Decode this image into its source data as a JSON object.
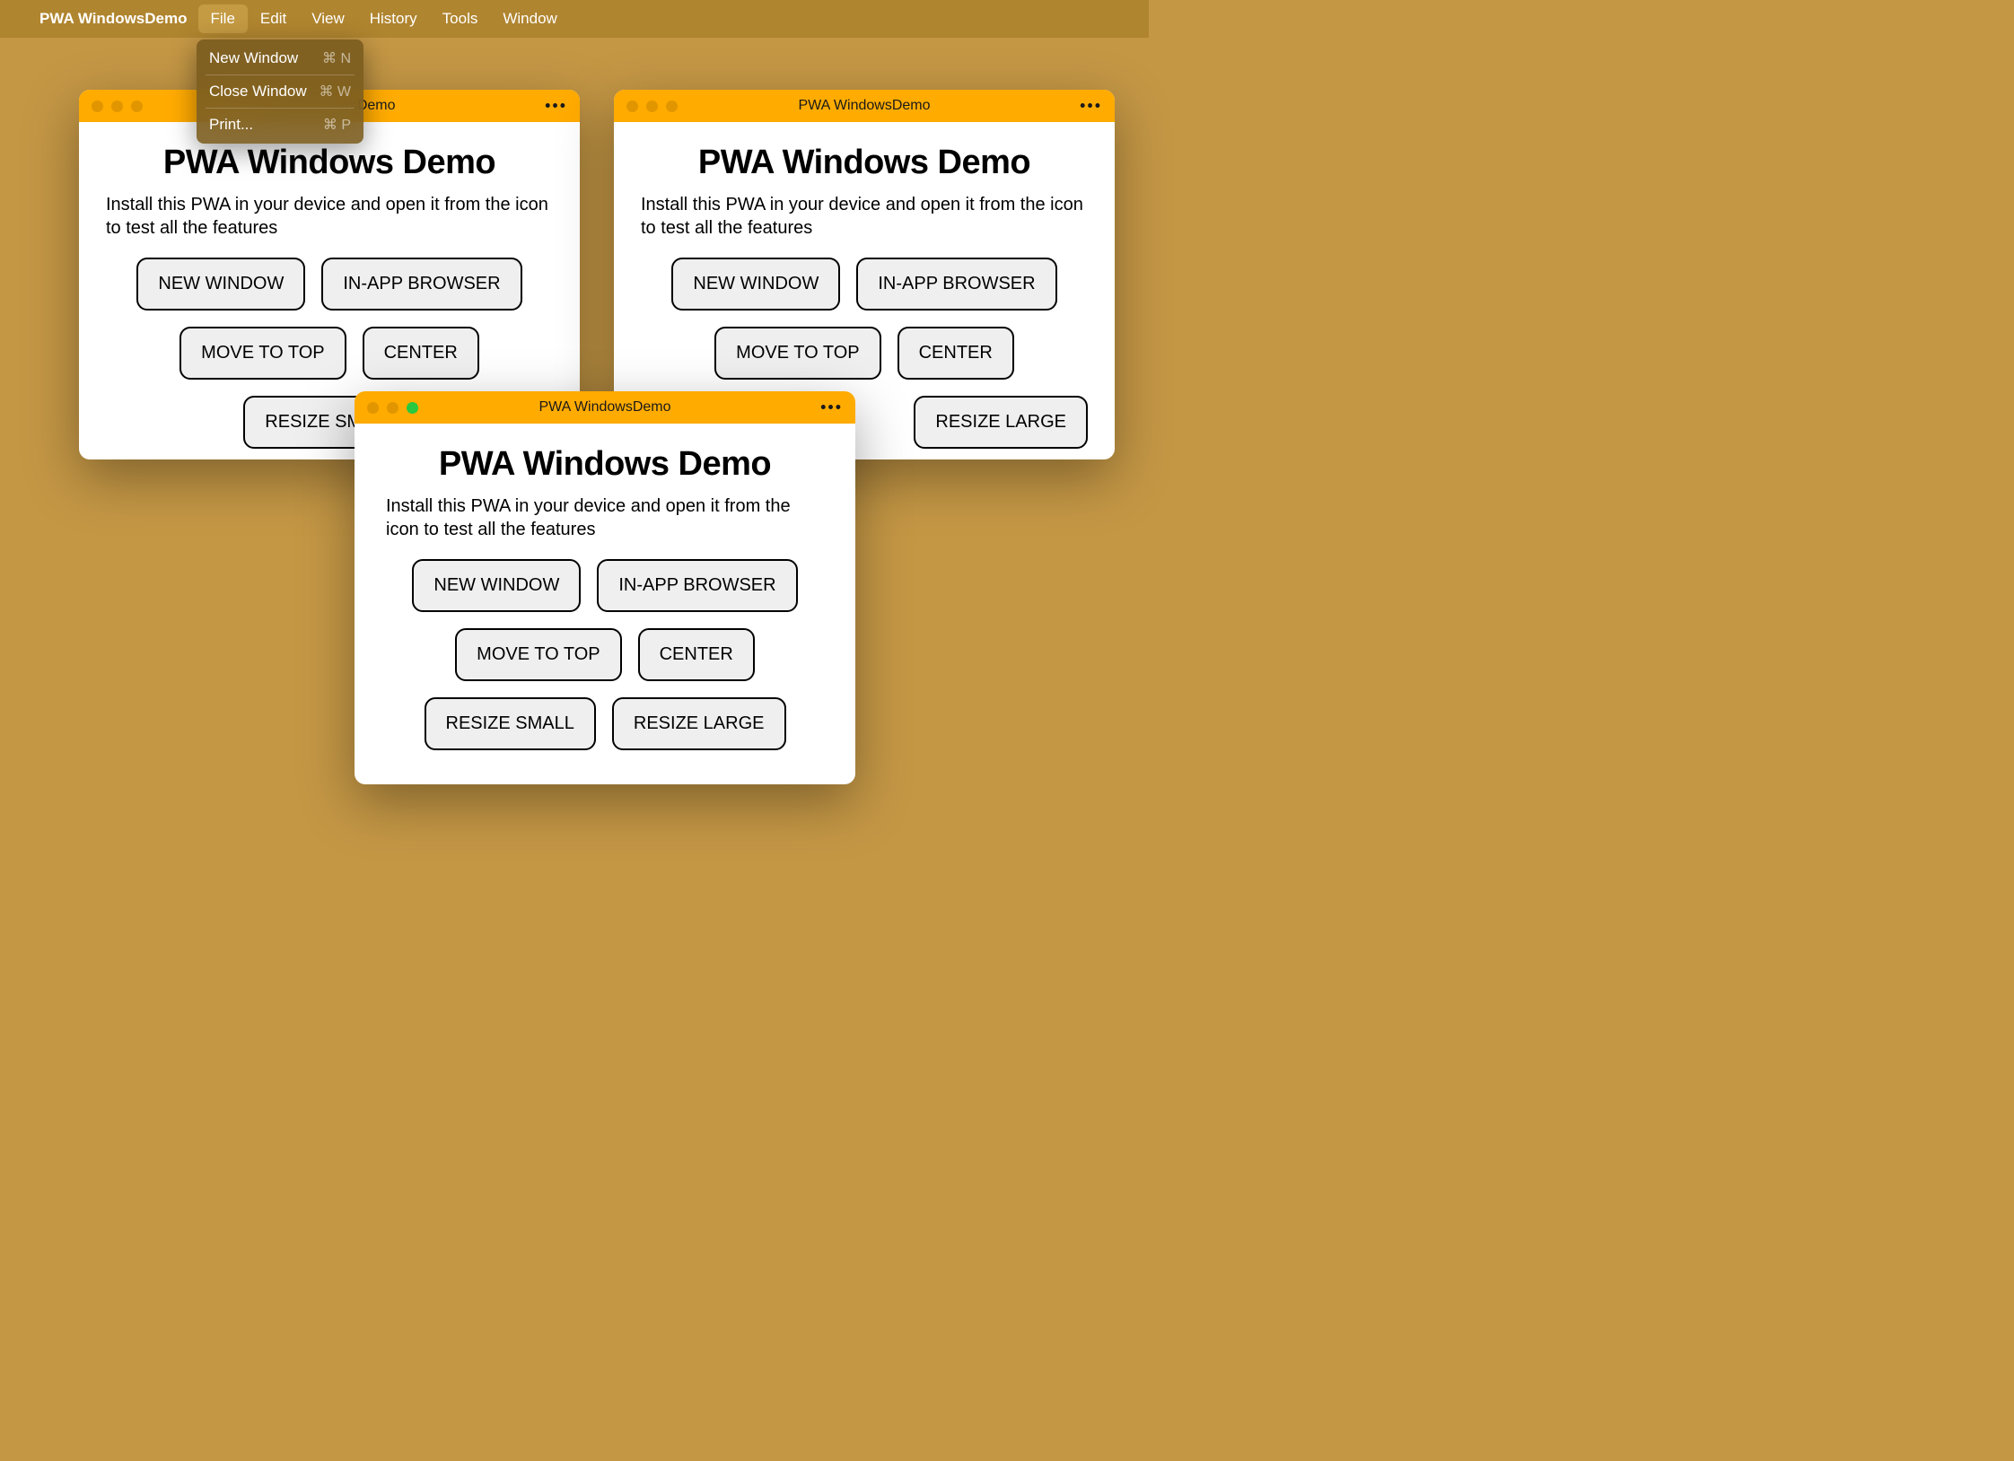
{
  "menubar": {
    "app_name": "PWA WindowsDemo",
    "items": [
      {
        "label": "File",
        "active": true
      },
      {
        "label": "Edit",
        "active": false
      },
      {
        "label": "View",
        "active": false
      },
      {
        "label": "History",
        "active": false
      },
      {
        "label": "Tools",
        "active": false
      },
      {
        "label": "Window",
        "active": false
      }
    ]
  },
  "dropdown": {
    "items": [
      {
        "label": "New Window",
        "shortcut": "⌘ N",
        "after_separator": true
      },
      {
        "label": "Close Window",
        "shortcut": "⌘ W",
        "after_separator": true
      },
      {
        "label": "Print...",
        "shortcut": "⌘ P",
        "after_separator": false
      }
    ]
  },
  "windows": [
    {
      "id": "w1",
      "active": false,
      "title": "PWA WindowsDemo",
      "heading": "PWA Windows Demo",
      "description": "Install this PWA in your device and open it from the icon to test all the features",
      "buttons": [
        "NEW WINDOW",
        "IN-APP BROWSER",
        "MOVE TO TOP",
        "CENTER",
        "RESIZE SMALL"
      ]
    },
    {
      "id": "w2",
      "active": false,
      "title": "PWA WindowsDemo",
      "heading": "PWA Windows Demo",
      "description": "Install this PWA in your device and open it from the icon to test all the features",
      "buttons": [
        "NEW WINDOW",
        "IN-APP BROWSER",
        "MOVE TO TOP",
        "CENTER",
        "RESIZE LARGE"
      ]
    },
    {
      "id": "w3",
      "active": true,
      "title": "PWA WindowsDemo",
      "heading": "PWA Windows Demo",
      "description": "Install this PWA in your device and open it from the icon to test all the features",
      "buttons": [
        "NEW WINDOW",
        "IN-APP BROWSER",
        "MOVE TO TOP",
        "CENTER",
        "RESIZE SMALL",
        "RESIZE LARGE"
      ]
    }
  ]
}
